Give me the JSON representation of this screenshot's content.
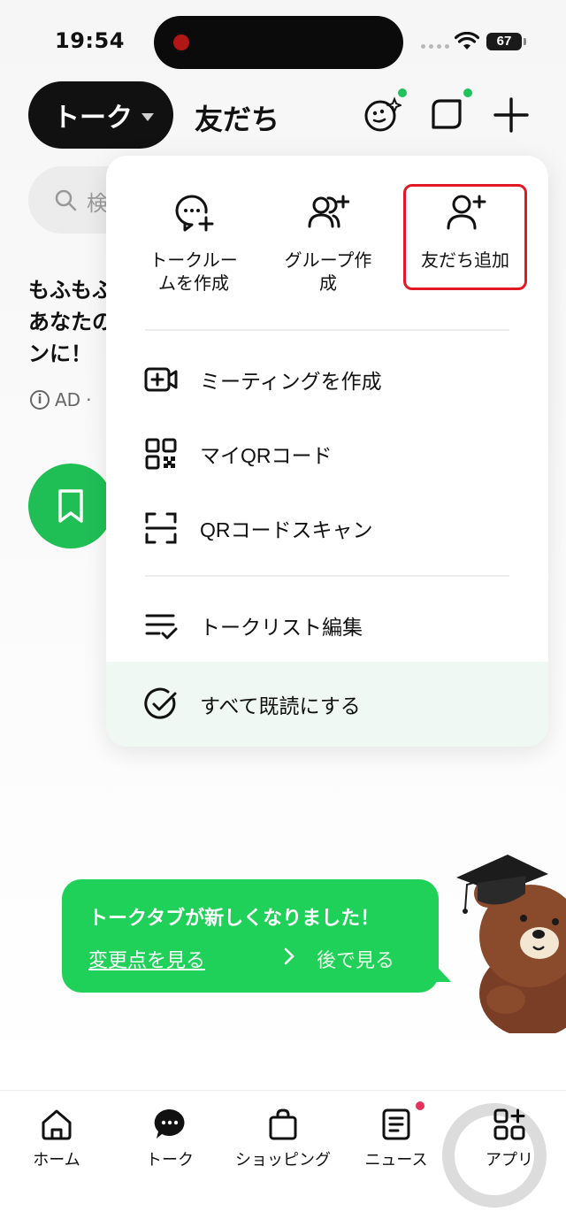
{
  "status_bar": {
    "time": "19:54",
    "battery": "67"
  },
  "header": {
    "active_tab": "トーク",
    "other_tab": "友だち",
    "icons": [
      "face-sparkle-icon",
      "chat-bubble-square-icon",
      "plus-icon"
    ]
  },
  "background": {
    "search_placeholder": "検",
    "ad_text_lines": [
      "もふもふ",
      "あなたの",
      "ンに！"
    ],
    "ad_label": "AD",
    "ad_separator": "·"
  },
  "menu": {
    "quick_actions": [
      {
        "label": "トークルー\nムを作成",
        "icon": "chat-plus-icon"
      },
      {
        "label": "グループ作\n成",
        "icon": "group-add-icon"
      },
      {
        "label": "友だち追加",
        "icon": "person-add-icon",
        "highlighted": true
      }
    ],
    "items": [
      {
        "label": "ミーティングを作成",
        "icon": "video-plus-icon"
      },
      {
        "label": "マイQRコード",
        "icon": "qr-code-icon"
      },
      {
        "label": "QRコードスキャン",
        "icon": "qr-scan-icon"
      },
      {
        "label": "トークリスト編集",
        "icon": "list-edit-icon"
      },
      {
        "label": "すべて既読にする",
        "icon": "check-circle-icon"
      }
    ]
  },
  "toast": {
    "title": "トークタブが新しくなりました！",
    "link": "変更点を見る",
    "later": "後で見る"
  },
  "tabbar": {
    "tabs": [
      {
        "label": "ホーム",
        "icon": "home-icon"
      },
      {
        "label": "トーク",
        "icon": "talk-bubble-icon"
      },
      {
        "label": "ショッピング",
        "icon": "shopping-bag-icon"
      },
      {
        "label": "ニュース",
        "icon": "news-icon"
      },
      {
        "label": "アプリ",
        "icon": "apps-grid-icon"
      }
    ]
  },
  "colors": {
    "accent": "#1fd159",
    "highlight_border": "#e01a24",
    "notification_dot": "#21c25e"
  }
}
